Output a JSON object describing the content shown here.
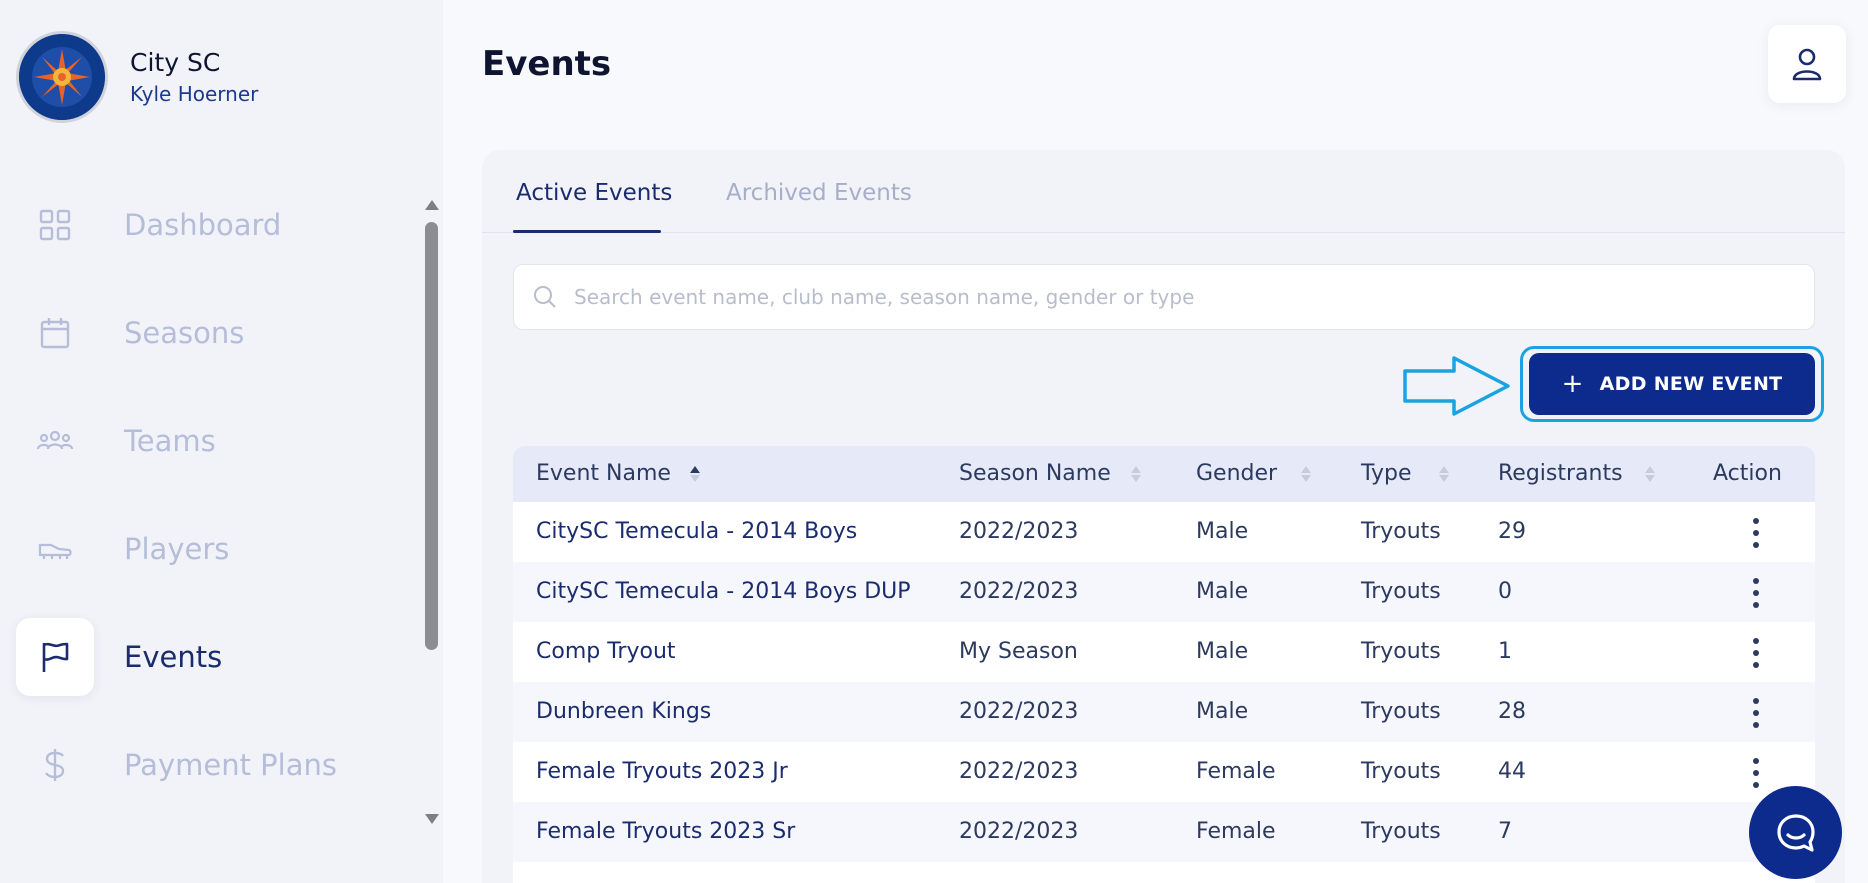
{
  "brand": {
    "name": "City SC",
    "user": "Kyle Hoerner",
    "logo_colors": {
      "ring": "#0d3a8a",
      "sun": "#e8632a",
      "accent": "#f3b53c"
    }
  },
  "sidebar": {
    "items": [
      {
        "label": "Dashboard",
        "icon": "grid-icon",
        "active": false
      },
      {
        "label": "Seasons",
        "icon": "calendar-icon",
        "active": false
      },
      {
        "label": "Teams",
        "icon": "users-icon",
        "active": false
      },
      {
        "label": "Players",
        "icon": "cleat-icon",
        "active": false
      },
      {
        "label": "Events",
        "icon": "flag-icon",
        "active": true
      },
      {
        "label": "Payment Plans",
        "icon": "dollar-icon",
        "active": false
      }
    ]
  },
  "header": {
    "title": "Events"
  },
  "tabs": [
    {
      "label": "Active Events",
      "active": true
    },
    {
      "label": "Archived Events",
      "active": false
    }
  ],
  "search": {
    "placeholder": "Search event name, club name, season name, gender or type",
    "value": ""
  },
  "actions": {
    "add_label": "ADD NEW EVENT"
  },
  "table": {
    "columns": [
      "Event Name",
      "Season Name",
      "Gender",
      "Type",
      "Registrants",
      "Action"
    ],
    "rows": [
      [
        "CitySC Temecula - 2014 Boys",
        "2022/2023",
        "Male",
        "Tryouts",
        "29"
      ],
      [
        "CitySC Temecula - 2014 Boys DUP",
        "2022/2023",
        "Male",
        "Tryouts",
        "0"
      ],
      [
        "Comp Tryout",
        "My Season",
        "Male",
        "Tryouts",
        "1"
      ],
      [
        "Dunbreen Kings",
        "2022/2023",
        "Male",
        "Tryouts",
        "28"
      ],
      [
        "Female Tryouts 2023 Jr",
        "2022/2023",
        "Female",
        "Tryouts",
        "44"
      ],
      [
        "Female Tryouts 2023 Sr",
        "2022/2023",
        "Female",
        "Tryouts",
        "7"
      ]
    ]
  },
  "colors": {
    "primary": "#0c2b8c",
    "highlight": "#1aa3e0",
    "text": "#1b2c6e",
    "muted": "#b5bdd9"
  }
}
